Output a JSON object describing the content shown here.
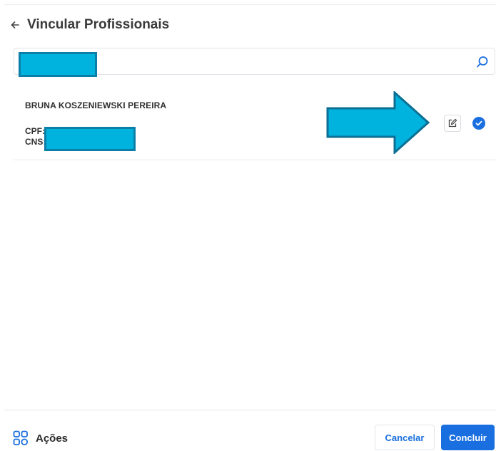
{
  "header": {
    "back_icon": "arrow-left-icon",
    "title": "Vincular Profissionais"
  },
  "search": {
    "value": "",
    "placeholder": "",
    "icon": "search-icon",
    "redacted": true
  },
  "professionals": [
    {
      "name": "BRUNA KOSZENIEWSKI PEREIRA",
      "cpf_label": "CPF:",
      "cns_label": "CNS:",
      "documents_redacted": true,
      "edit_icon": "edit-icon",
      "selected": true,
      "selected_icon": "check-circle-icon"
    }
  ],
  "annotation": {
    "type": "arrow-right",
    "color": "#00b3de"
  },
  "footer": {
    "actions_icon": "grid-icon",
    "actions_label": "Ações",
    "cancel_label": "Cancelar",
    "confirm_label": "Concluir"
  },
  "colors": {
    "accent": "#1a6fe0",
    "redaction_fill": "#00b3de",
    "redaction_border": "#0b7fa8"
  }
}
